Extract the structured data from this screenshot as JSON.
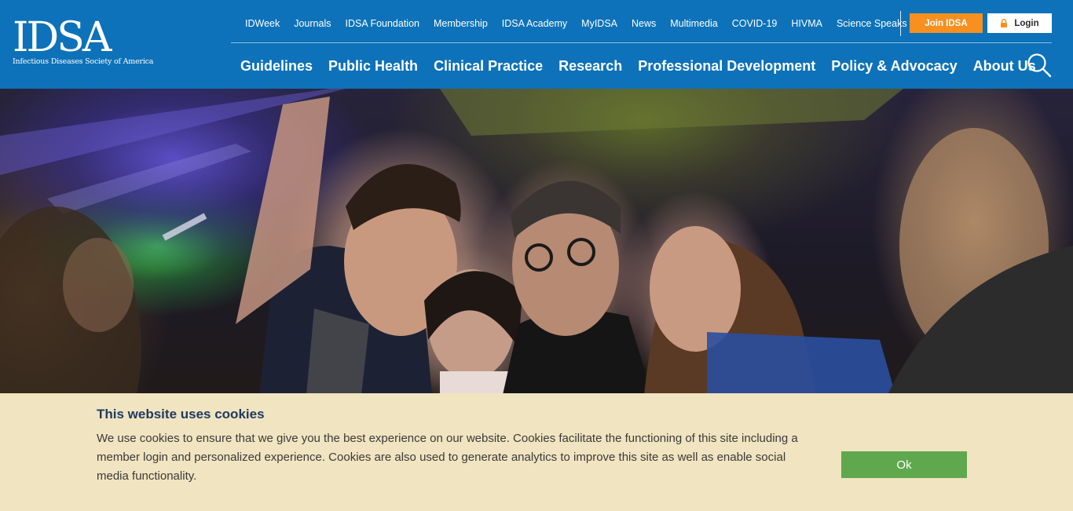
{
  "logo": {
    "title": "IDSA",
    "subtitle": "Infectious Diseases Society of America"
  },
  "utility_nav": [
    {
      "label": "IDWeek"
    },
    {
      "label": "Journals"
    },
    {
      "label": "IDSA Foundation"
    },
    {
      "label": "Membership"
    },
    {
      "label": "IDSA Academy"
    },
    {
      "label": "MyIDSA"
    },
    {
      "label": "News"
    },
    {
      "label": "Multimedia"
    },
    {
      "label": "COVID-19"
    },
    {
      "label": "HIVMA"
    },
    {
      "label": "Science Speaks"
    }
  ],
  "actions": {
    "join_label": "Join IDSA",
    "login_label": "Login",
    "join_color": "#f7901e"
  },
  "main_nav": [
    {
      "label": "Guidelines"
    },
    {
      "label": "Public Health"
    },
    {
      "label": "Clinical Practice"
    },
    {
      "label": "Research"
    },
    {
      "label": "Professional Development"
    },
    {
      "label": "Policy & Advocacy"
    },
    {
      "label": "About Us"
    }
  ],
  "cookie": {
    "title": "This website uses cookies",
    "text": "We use cookies to ensure that we give you the best experience on our website. Cookies facilitate the functioning of this site including a member login and personalized experience. Cookies are also used to generate analytics to improve this site as well as enable social media functionality.",
    "ok_label": "Ok"
  },
  "colors": {
    "header_bg": "#0d72b9",
    "cookie_bg": "#f1e4c0",
    "ok_button": "#5fa84d",
    "cookie_title": "#1f3a63"
  },
  "icons": {
    "lock": "lock-icon",
    "search": "search-icon"
  }
}
